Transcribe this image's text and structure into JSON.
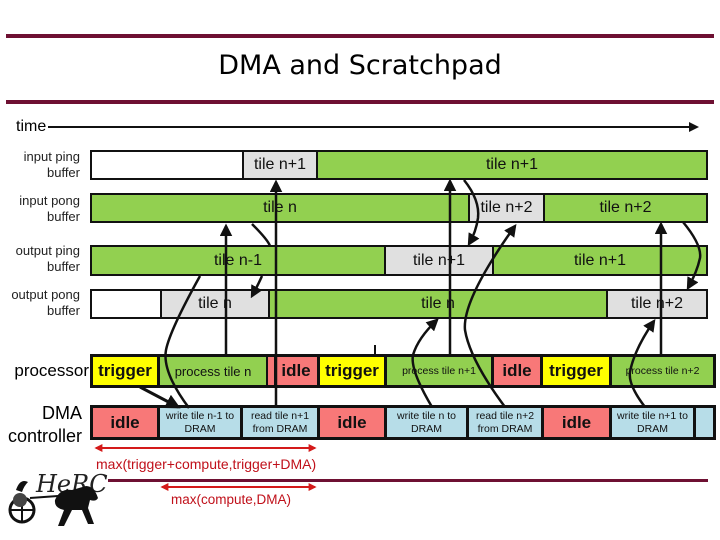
{
  "title": "DMA and Scratchpad",
  "time_label": "time",
  "colors": {
    "rule": "#6e1032",
    "busy_green": "#92d050",
    "transfer_gray": "#e0e0e0",
    "trigger_yellow": "#ffff00",
    "idle_red": "#f87878",
    "dma_blue": "#b7dde8",
    "annotation_red": "#c0101a"
  },
  "buffers": [
    {
      "label_line1": "input ping",
      "label_line2": "buffer",
      "segments": [
        {
          "text": "",
          "kind": "empty"
        },
        {
          "text": "tile n+1",
          "kind": "gray"
        },
        {
          "text": "tile n+1",
          "kind": "green"
        }
      ]
    },
    {
      "label_line1": "input pong",
      "label_line2": "buffer",
      "segments": [
        {
          "text": "tile n",
          "kind": "green"
        },
        {
          "text": "tile n+2",
          "kind": "gray"
        },
        {
          "text": "tile n+2",
          "kind": "green"
        }
      ]
    },
    {
      "label_line1": "output ping",
      "label_line2": "buffer",
      "segments": [
        {
          "text": "tile n-1",
          "kind": "green"
        },
        {
          "text": "tile n+1",
          "kind": "gray"
        },
        {
          "text": "tile n+1",
          "kind": "green"
        }
      ]
    },
    {
      "label_line1": "output pong",
      "label_line2": "buffer",
      "segments": [
        {
          "text": "",
          "kind": "empty"
        },
        {
          "text": "tile n",
          "kind": "gray"
        },
        {
          "text": "tile n",
          "kind": "green"
        },
        {
          "text": "tile n+2",
          "kind": "gray"
        }
      ]
    }
  ],
  "processor": {
    "label": "processor",
    "segments": [
      {
        "text": "trigger",
        "kind": "yellow"
      },
      {
        "text": "process tile n",
        "kind": "green"
      },
      {
        "text": "",
        "kind": "red"
      },
      {
        "text": "idle",
        "kind": "red"
      },
      {
        "text": "trigger",
        "kind": "yellow"
      },
      {
        "text": "process tile n+1",
        "kind": "green"
      },
      {
        "text": "idle",
        "kind": "red"
      },
      {
        "text": "trigger",
        "kind": "yellow"
      },
      {
        "text": "process tile n+2",
        "kind": "green"
      }
    ]
  },
  "dma": {
    "label_line1": "DMA",
    "label_line2": "controller",
    "segments": [
      {
        "text": "idle",
        "kind": "red"
      },
      {
        "text_line1": "write tile n-1 to",
        "text_line2": "DRAM",
        "kind": "blue"
      },
      {
        "text_line1": "read tile n+1",
        "text_line2": "from DRAM",
        "kind": "blue"
      },
      {
        "text": "idle",
        "kind": "red"
      },
      {
        "text_line1": "write tile n to",
        "text_line2": "DRAM",
        "kind": "blue"
      },
      {
        "text_line1": "read tile n+2",
        "text_line2": "from DRAM",
        "kind": "blue"
      },
      {
        "text": "idle",
        "kind": "red"
      },
      {
        "text_line1": "write tile n+1 to",
        "text_line2": "DRAM",
        "kind": "blue"
      },
      {
        "text": "",
        "kind": "blue"
      }
    ]
  },
  "annotations": {
    "first_period": "max(trigger+compute,trigger+DMA)",
    "steady_period": "max(compute,DMA)"
  },
  "logo": {
    "text": "HeRC",
    "icon": "chariot-logo-icon"
  }
}
